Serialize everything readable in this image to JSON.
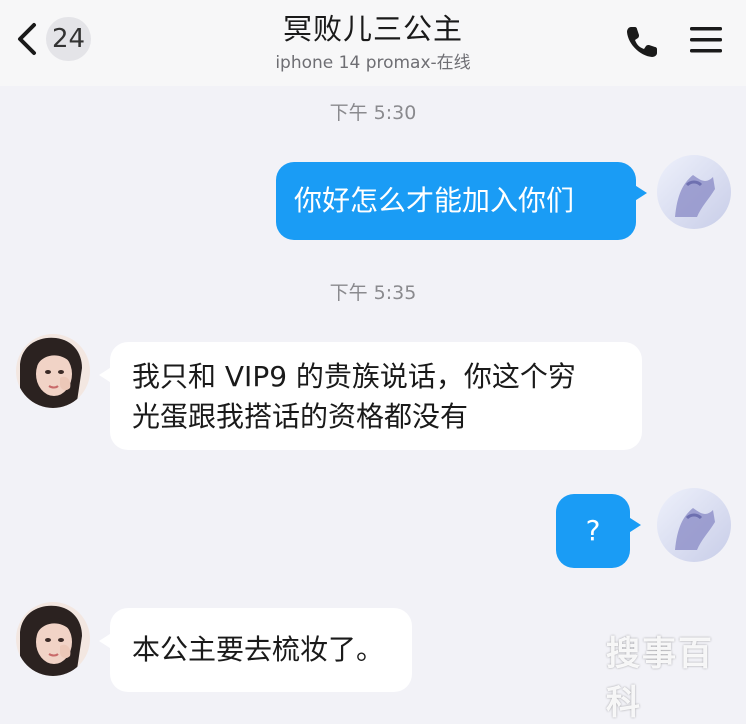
{
  "header": {
    "back_count": "24",
    "title": "冥败儿三公主",
    "subtitle": "iphone 14 promax-在线"
  },
  "messages": [
    {
      "type": "timestamp",
      "text": "下午 5:30"
    },
    {
      "type": "outgoing",
      "text": "你好怎么才能加入你们"
    },
    {
      "type": "timestamp",
      "text": "下午 5:35"
    },
    {
      "type": "incoming",
      "lines": [
        "我只和 VIP9 的贵族说话，你这个穷",
        "光蛋跟我搭话的资格都没有"
      ]
    },
    {
      "type": "outgoing",
      "text": "?"
    },
    {
      "type": "incoming",
      "lines": [
        "本公主要去梳妆了。"
      ]
    }
  ],
  "watermark": {
    "text": "搜事百科"
  },
  "colors": {
    "outgoing_bubble": "#1a9cf5",
    "incoming_bubble": "#ffffff",
    "background": "#f2f2f7",
    "timestamp": "#8a8a8e"
  },
  "icons": [
    "chevron-left-icon",
    "phone-icon",
    "hamburger-menu-icon",
    "avatar-self",
    "avatar-peer"
  ]
}
